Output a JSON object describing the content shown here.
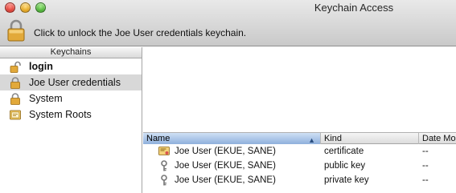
{
  "window": {
    "title": "Keychain Access"
  },
  "toolbar": {
    "unlock_text": "Click to unlock the Joe User credentials keychain.",
    "lock_icon": "lock-icon"
  },
  "sidebar": {
    "header": "Keychains",
    "items": [
      {
        "label": "login",
        "icon": "lock-open-icon",
        "bold": true,
        "selected": false
      },
      {
        "label": "Joe User credentials",
        "icon": "lock-icon",
        "bold": false,
        "selected": true
      },
      {
        "label": "System",
        "icon": "lock-icon",
        "bold": false,
        "selected": false
      },
      {
        "label": "System Roots",
        "icon": "certificate-cabinet-icon",
        "bold": false,
        "selected": false
      }
    ]
  },
  "table": {
    "columns": [
      "Name",
      "Kind",
      "Date Mo"
    ],
    "sorted_column": "Name",
    "rows": [
      {
        "icon": "certificate-icon",
        "name": "Joe User (EKUE, SANE)",
        "kind": "certificate",
        "date": "--"
      },
      {
        "icon": "key-icon",
        "name": "Joe User (EKUE, SANE)",
        "kind": "public key",
        "date": "--"
      },
      {
        "icon": "key-icon",
        "name": "Joe User (EKUE, SANE)",
        "kind": "private key",
        "date": "--"
      }
    ]
  },
  "colors": {
    "selected_sidebar": "#d8d8d8",
    "sorted_header": "#8fb0dc",
    "lock_gold": "#e2a93a"
  }
}
